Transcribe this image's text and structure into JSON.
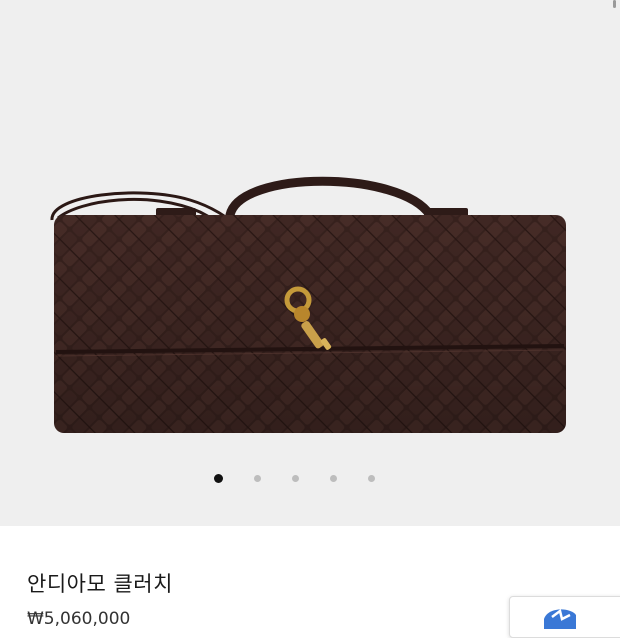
{
  "gallery": {
    "image_alt": "bag-photo",
    "slide_count": 5,
    "active_slide": 1
  },
  "product": {
    "name": "안디아모 클러치",
    "price": "₩5,060,000"
  },
  "widget": {
    "icon": "chat-icon"
  },
  "colors": {
    "gallery_bg": "#efefef",
    "leather": "#3b2420",
    "hardware": "#c49a3a",
    "widget_blue": "#3a78d6"
  }
}
